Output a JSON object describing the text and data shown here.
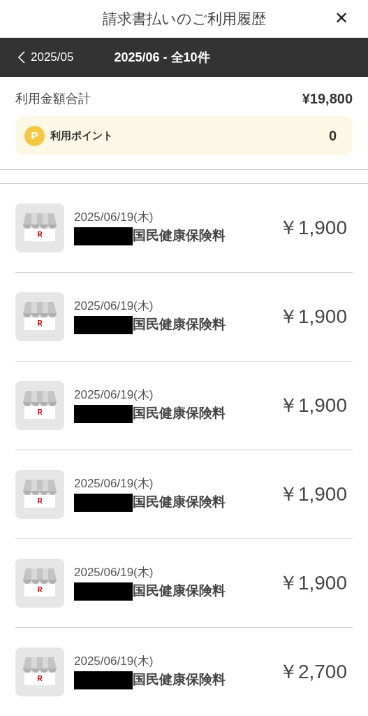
{
  "header": {
    "title": "請求書払いのご利用履歴",
    "close": "✕"
  },
  "month_bar": {
    "previous": "2025/05",
    "current": "2025/06 - 全10件"
  },
  "summary": {
    "label": "利用金額合計",
    "total": "¥19,800",
    "points": {
      "badge": "P",
      "label": "利用ポイント",
      "value": "0"
    }
  },
  "transactions": [
    {
      "logo": "R",
      "date": "2025/06/19(木)",
      "name": "国民健康保険料",
      "amount": "￥1,900"
    },
    {
      "logo": "R",
      "date": "2025/06/19(木)",
      "name": "国民健康保険料",
      "amount": "￥1,900"
    },
    {
      "logo": "R",
      "date": "2025/06/19(木)",
      "name": "国民健康保険料",
      "amount": "￥1,900"
    },
    {
      "logo": "R",
      "date": "2025/06/19(木)",
      "name": "国民健康保険料",
      "amount": "￥1,900"
    },
    {
      "logo": "R",
      "date": "2025/06/19(木)",
      "name": "国民健康保険料",
      "amount": "￥1,900"
    },
    {
      "logo": "R",
      "date": "2025/06/19(木)",
      "name": "国民健康保険料",
      "amount": "￥2,700"
    }
  ]
}
